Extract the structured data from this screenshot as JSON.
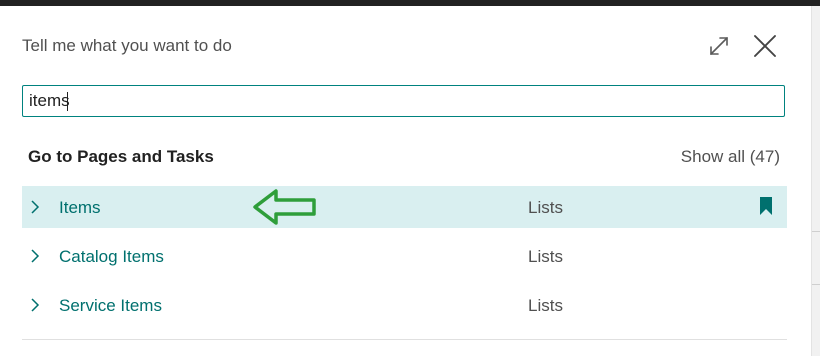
{
  "dialog": {
    "title": "Tell me what you want to do",
    "expand_icon": "expand-diagonal-icon",
    "close_icon": "close-icon"
  },
  "search": {
    "value": "items"
  },
  "section": {
    "title": "Go to Pages and Tasks",
    "show_all": "Show all (47)"
  },
  "results": [
    {
      "name": "Items",
      "category": "Lists",
      "bookmarked": true,
      "selected": true
    },
    {
      "name": "Catalog Items",
      "category": "Lists",
      "bookmarked": false,
      "selected": false
    },
    {
      "name": "Service Items",
      "category": "Lists",
      "bookmarked": false,
      "selected": false
    }
  ],
  "colors": {
    "accent": "#00827f",
    "link": "#00706e",
    "selected_row": "#d9eff0",
    "annotation_arrow": "#2e9e3a"
  }
}
